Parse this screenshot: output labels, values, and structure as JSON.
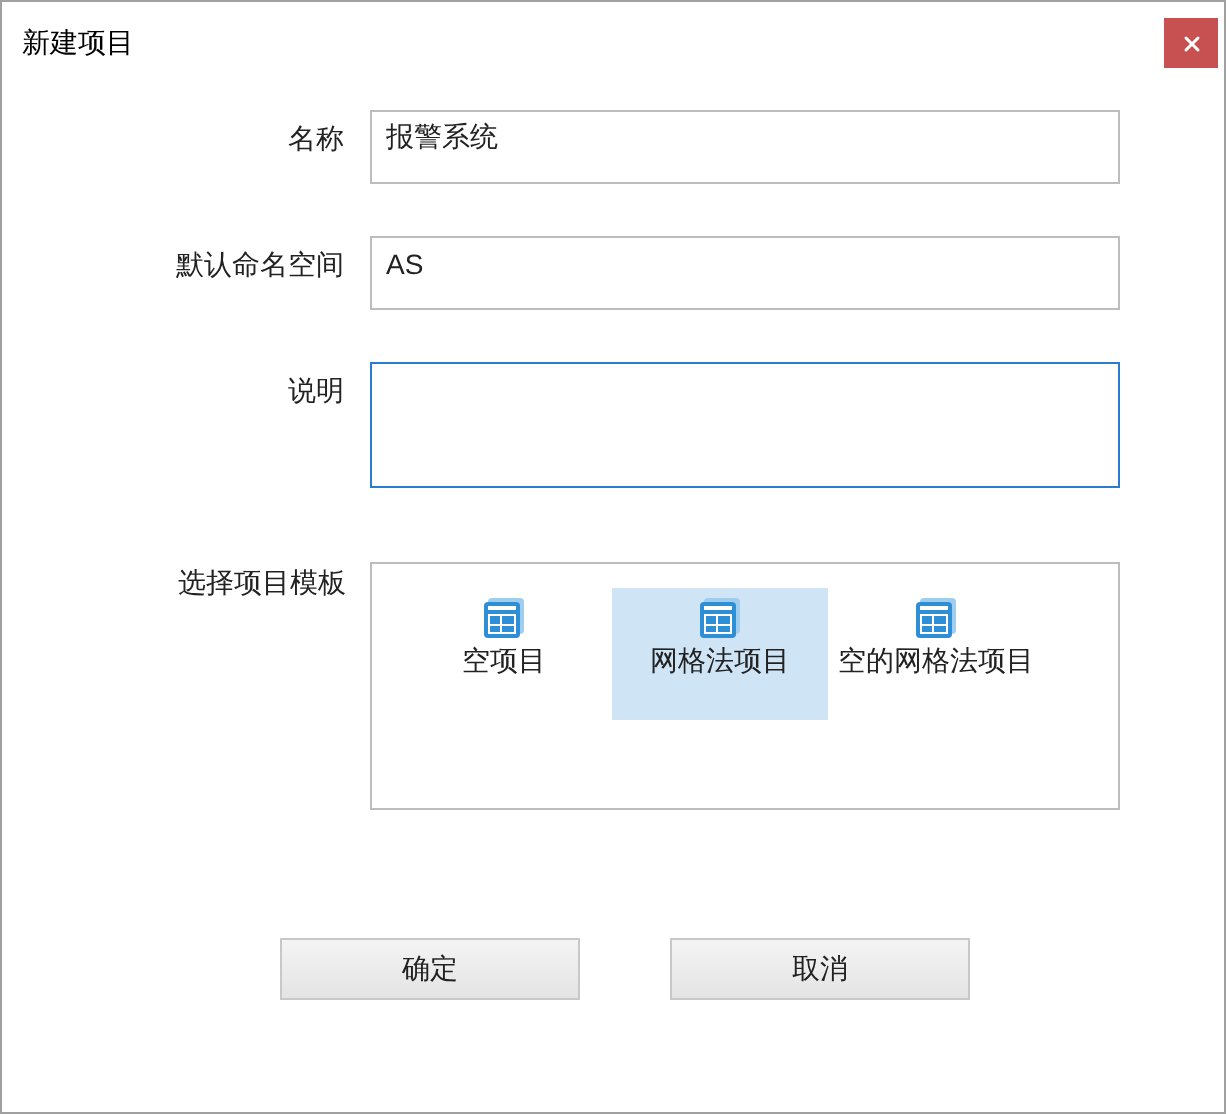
{
  "window": {
    "title": "新建项目"
  },
  "fields": [
    {
      "label": "名称",
      "value": "报警系统",
      "focused": false,
      "kind": "single"
    },
    {
      "label": "默认命名空间",
      "value": "AS",
      "focused": false,
      "kind": "single"
    },
    {
      "label": "说明",
      "focused": true,
      "kind": "multi"
    }
  ],
  "templates": {
    "label": "选择项目模板",
    "items": [
      {
        "label": "空项目",
        "selected": false
      },
      {
        "label": "网格法项目",
        "selected": true
      },
      {
        "label": "空的网格法项目",
        "selected": false
      }
    ]
  },
  "buttons": [
    "确定",
    "取消"
  ]
}
